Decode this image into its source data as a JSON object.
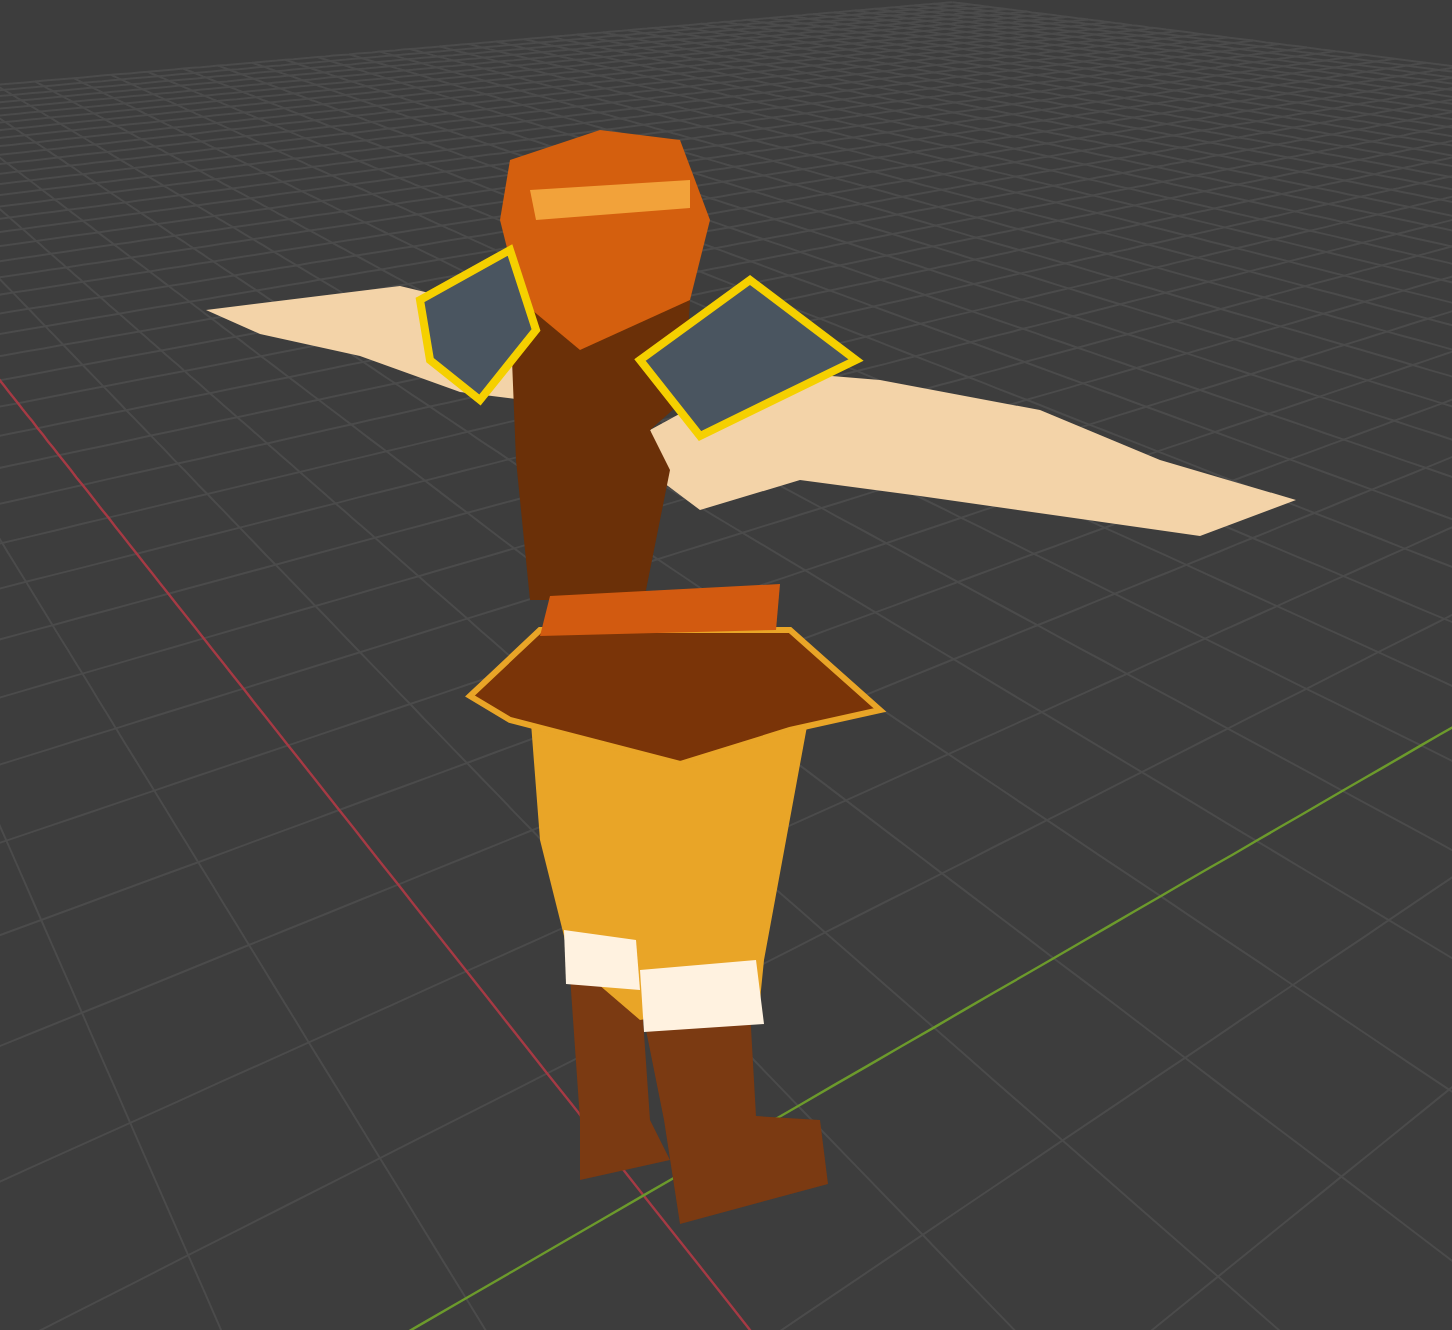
{
  "viewport": {
    "kind": "viewport",
    "grid": true,
    "axes": true
  }
}
